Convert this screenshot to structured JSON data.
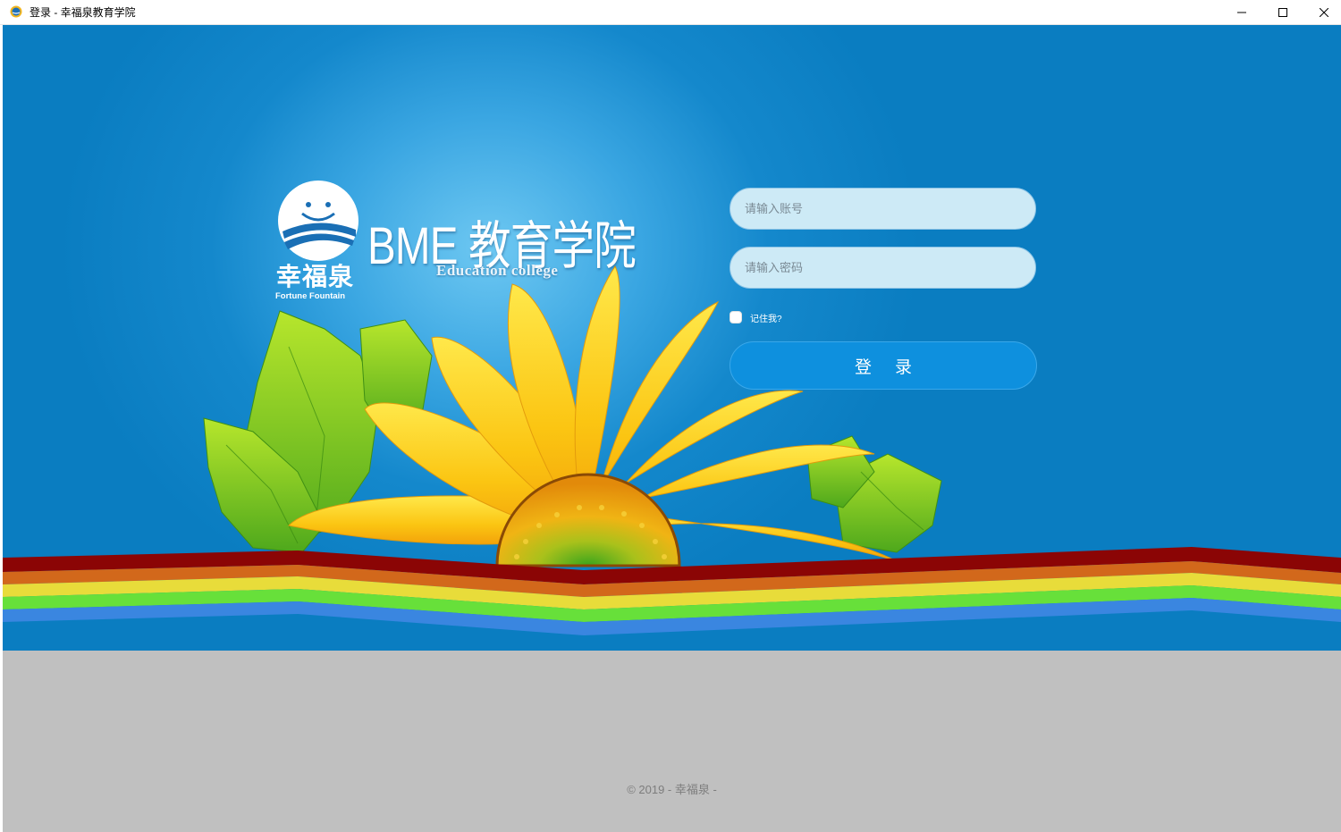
{
  "window": {
    "title": "登录 - 幸福泉教育学院",
    "controls": {
      "minimize_icon": "minimize-icon",
      "maximize_icon": "maximize-icon",
      "close_icon": "close-icon"
    }
  },
  "brand": {
    "logo_cn": "幸福泉",
    "logo_en": "Fortune Fountain",
    "title": "BME 教育学院",
    "subtitle": "Education college"
  },
  "login": {
    "username_placeholder": "请输入账号",
    "password_placeholder": "请输入密码",
    "remember_label": "记住我?",
    "remember_checked": false,
    "submit_label": "登 录"
  },
  "footer": {
    "text": "© 2019 - 幸福泉 -"
  },
  "colors": {
    "sky": "#0a7dc1",
    "input_bg": "#cdeaf6",
    "button_bg": "#0e90de",
    "ground": "#c0c0c0"
  }
}
